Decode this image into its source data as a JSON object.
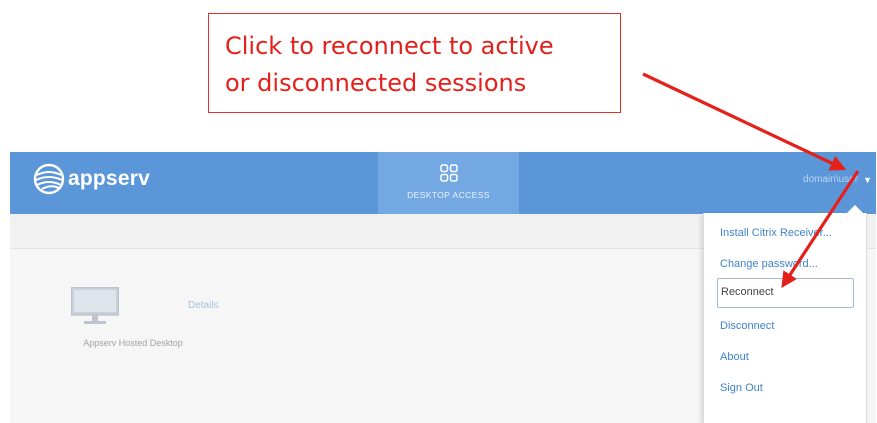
{
  "callout": {
    "lines": [
      "Click to reconnect to active",
      "or disconnected sessions"
    ],
    "color": "#e4201a"
  },
  "header": {
    "logo_text": "appserv",
    "nav_tab": {
      "label": "DESKTOP ACCESS",
      "icon": "grid-icon"
    },
    "user_name": "domain\\user",
    "background": "#5b96d8"
  },
  "content": {
    "desktop_label": "Appserv Hosted Desktop",
    "details_link": "Details",
    "icon": "monitor-icon"
  },
  "dropdown": {
    "items": [
      {
        "label": "Install Citrix Receiver...",
        "highlighted": false
      },
      {
        "label": "Change password...",
        "highlighted": false
      },
      {
        "label": "Reconnect",
        "highlighted": true
      },
      {
        "label": "Disconnect",
        "highlighted": false
      },
      {
        "label": "About",
        "highlighted": false
      },
      {
        "label": "Sign Out",
        "highlighted": false
      }
    ]
  },
  "colors": {
    "arrow": "#e4201a",
    "accent": "#3f83cc"
  }
}
